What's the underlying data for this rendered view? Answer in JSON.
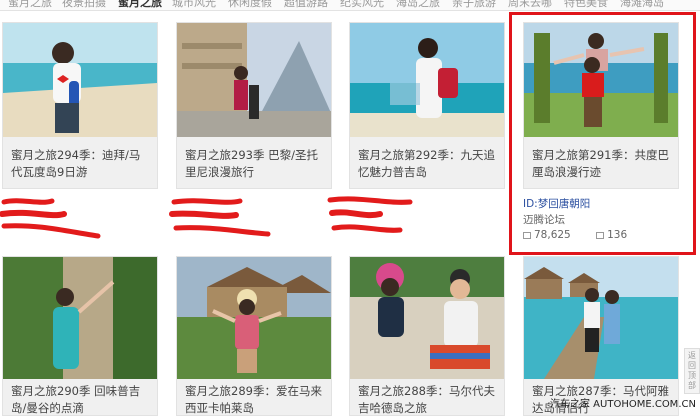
{
  "topnav": {
    "tabs": [
      "蜜月之旅",
      "夜景拍摄",
      "蜜月之旅",
      "城市风光",
      "休闲度假",
      "超值游路",
      "纪实风光",
      "海岛之旅",
      "亲子旅游",
      "周末去哪",
      "特色美食",
      "海滩海岛"
    ],
    "active_index": 2
  },
  "cards_row1": [
    {
      "title": "蜜月之旅294季：迪拜/马代瓦度岛9日游"
    },
    {
      "title": "蜜月之旅293季 巴黎/圣托里尼浪漫旅行"
    },
    {
      "title": "蜜月之旅第292季：九天追忆魅力普吉岛"
    },
    {
      "title": "蜜月之旅第291季：共度巴厘岛浪漫行迹"
    }
  ],
  "cards_row2": [
    {
      "title": "蜜月之旅290季 回味普吉岛/曼谷的点滴"
    },
    {
      "title": "蜜月之旅289季：爱在马来西亚卡帕莱岛"
    },
    {
      "title": "蜜月之旅288季：马尔代夫吉哈德岛之旅"
    },
    {
      "title": "蜜月之旅287季：马代阿雅达岛情侣行"
    }
  ],
  "highlight_meta": {
    "author": "ID:梦回唐朝阳",
    "forum": "迈腾论坛",
    "views": "78,625",
    "replies": "136"
  },
  "colors": {
    "highlight_border": "#e0141a",
    "author_link": "#2b4fa0",
    "redaction": "#e21b1b"
  },
  "backtop_label": "返回顶部",
  "watermark": "汽车之家 AUTOHOME.COM.CN"
}
